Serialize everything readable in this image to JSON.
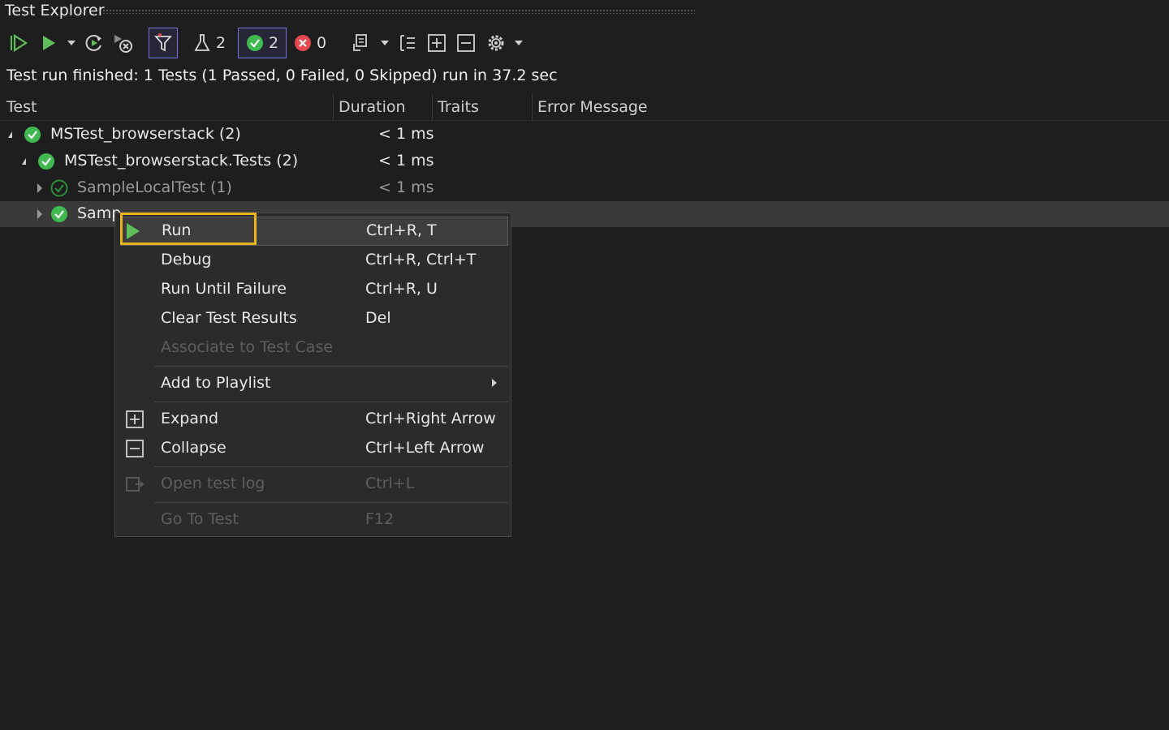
{
  "window": {
    "title": "Test Explorer"
  },
  "toolbar": {
    "total_count": "2",
    "passed_count": "2",
    "failed_count": "0",
    "icons": [
      "run-all-icon",
      "run-icon",
      "dropdown-icon",
      "repeat-last-run-icon",
      "cancel-run-icon",
      "filter-icon",
      "flask-icon",
      "passed-icon",
      "failed-icon",
      "playlist-icon",
      "group-by-icon",
      "expand-all-icon",
      "collapse-all-icon",
      "settings-icon"
    ]
  },
  "status": {
    "text": "Test run finished: 1 Tests (1 Passed, 0 Failed, 0 Skipped) run in 37.2 sec"
  },
  "columns": [
    "Test",
    "Duration",
    "Traits",
    "Error Message"
  ],
  "tree": [
    {
      "name": "MSTest_browserstack  (2)",
      "duration": "< 1 ms",
      "state": "passed"
    },
    {
      "name": "MSTest_browserstack.Tests  (2)",
      "duration": "< 1 ms",
      "state": "passed"
    },
    {
      "name": "SampleLocalTest  (1)",
      "duration": "< 1 ms",
      "state": "passed-stale"
    },
    {
      "name": "Samp",
      "duration": "",
      "state": "passed"
    }
  ],
  "context_menu": {
    "items": [
      {
        "label": "Run",
        "shortcut": "Ctrl+R, T",
        "icon": "run-icon",
        "enabled": true
      },
      {
        "label": "Debug",
        "shortcut": "Ctrl+R, Ctrl+T",
        "enabled": true
      },
      {
        "label": "Run Until Failure",
        "shortcut": "Ctrl+R, U",
        "enabled": true
      },
      {
        "label": "Clear Test Results",
        "shortcut": "Del",
        "enabled": true
      },
      {
        "label": "Associate to Test Case",
        "shortcut": "",
        "enabled": false
      },
      {
        "label": "Add to Playlist",
        "shortcut": "",
        "enabled": true,
        "submenu": true
      },
      {
        "label": "Expand",
        "shortcut": "Ctrl+Right Arrow",
        "icon": "expand-icon",
        "enabled": true
      },
      {
        "label": "Collapse",
        "shortcut": "Ctrl+Left Arrow",
        "icon": "collapse-icon",
        "enabled": true
      },
      {
        "label": "Open test log",
        "shortcut": "Ctrl+L",
        "icon": "open-log-icon",
        "enabled": false
      },
      {
        "label": "Go To Test",
        "shortcut": "F12",
        "enabled": false
      }
    ]
  },
  "colors": {
    "background": "#1e1e1e",
    "passed": "#3fb950",
    "failed": "#e5484d",
    "highlight": "#e8b51d",
    "run": "#5fbe5a"
  }
}
